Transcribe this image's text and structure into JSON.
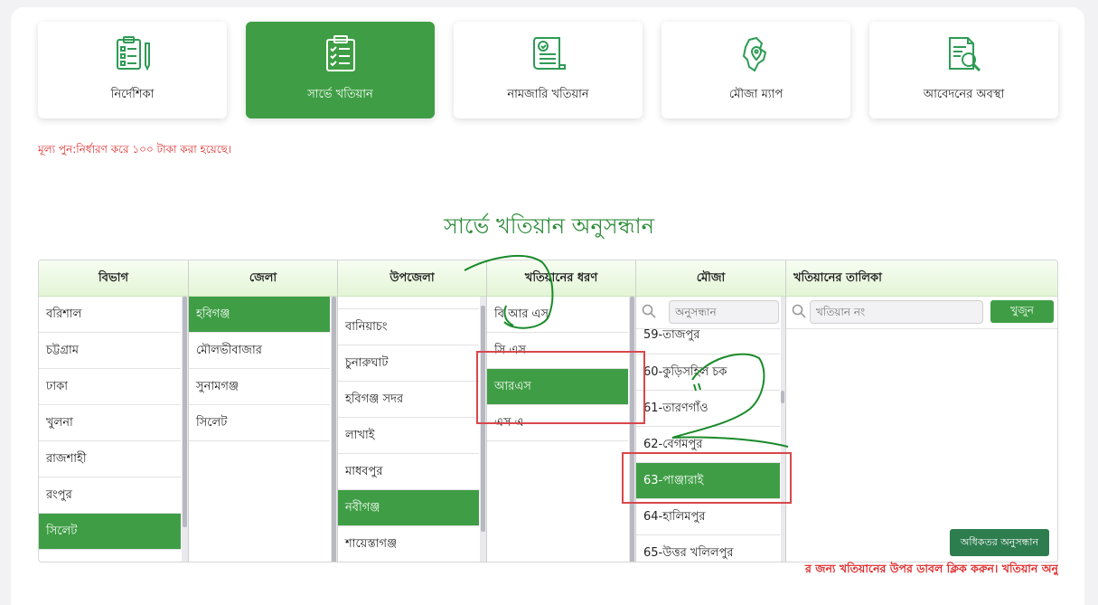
{
  "nav_tiles": [
    {
      "label": "নির্দেশিকা",
      "icon": "checklist-pen-icon",
      "active": false
    },
    {
      "label": "সার্ভে খতিয়ান",
      "icon": "clipboard-checklist-icon",
      "active": true
    },
    {
      "label": "নামজারি খতিয়ান",
      "icon": "scroll-document-icon",
      "active": false
    },
    {
      "label": "মৌজা ম্যাপ",
      "icon": "map-pin-icon",
      "active": false
    },
    {
      "label": "আবেদনের অবস্থা",
      "icon": "document-search-icon",
      "active": false
    }
  ],
  "notice": "মূল্য পুন:নির্ধারণ করে ১০০ টাকা করা হয়েছে।",
  "heading": "সার্ভে খতিয়ান অনুসন্ধান",
  "columns": {
    "division": {
      "header": "বিভাগ",
      "items": [
        "বরিশাল",
        "চট্টগ্রাম",
        "ঢাকা",
        "খুলনা",
        "রাজশাহী",
        "রংপুর",
        "সিলেট"
      ],
      "selected": "সিলেট"
    },
    "district": {
      "header": "জেলা",
      "items": [
        "হবিগঞ্জ",
        "মৌলভীবাজার",
        "সুনামগঞ্জ",
        "সিলেট"
      ],
      "selected": "হবিগঞ্জ"
    },
    "upazila": {
      "header": "উপজেলা",
      "items": [
        "বানিয়াচং",
        "চুনারুঘাট",
        "হবিগঞ্জ সদর",
        "লাখাই",
        "মাধবপুর",
        "নবীগঞ্জ",
        "শায়েস্তাগঞ্জ"
      ],
      "selected": "নবীগঞ্জ"
    },
    "khatian_type": {
      "header": "খতিয়ানের ধরণ",
      "items": [
        "বি আর এস",
        "সি এস",
        "আরএস",
        "এস এ"
      ],
      "selected": "আরএস"
    },
    "mouza": {
      "header": "মৌজা",
      "search_placeholder": "অনুসন্ধান",
      "items": [
        "59-তাজপুর",
        "60-কুড়িসহিল চক",
        "61-তারণগাঁও",
        "62-বেগমপুর",
        "63-পাঞ্জারাই",
        "64-হালিমপুর",
        "65-উত্তর খলিলপুর"
      ],
      "selected": "63-পাঞ্জারাই"
    },
    "khatian_list": {
      "header": "খতিয়ানের তালিকা",
      "search_placeholder": "খতিয়ান নং",
      "search_button": "খুজুন",
      "more_button": "অধিকতর অনুসন্ধান"
    }
  },
  "footer_note": "র জন্য খতিয়ানের উপর ডাবল ক্লিক করুন। খতিয়ান অনু",
  "colors": {
    "accent": "#3f9e45",
    "alert": "#e02b2b",
    "annotation_box": "#d8474b",
    "scribble": "#1a8a2a"
  }
}
